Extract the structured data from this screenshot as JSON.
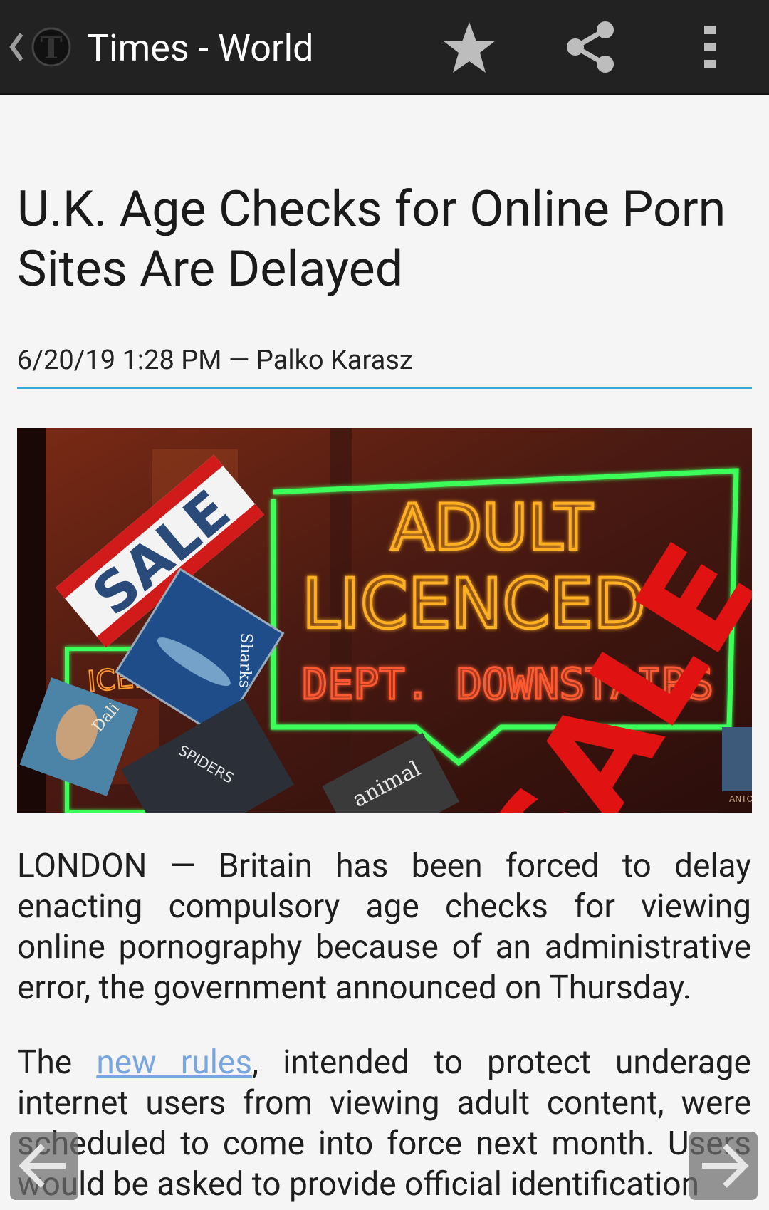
{
  "appbar": {
    "title": "Times - World",
    "icons": [
      "back-chevron-icon",
      "nyt-logo-icon",
      "star-icon",
      "share-icon",
      "overflow-menu-icon"
    ],
    "colors": {
      "background": "#222222",
      "text": "#ffffff",
      "icon": "#bdbdbd"
    }
  },
  "article": {
    "headline": "U.K. Age Checks for Online Porn Sites Are Delayed",
    "byline": "6/20/19 1:28 PM — Palko Karasz",
    "image": {
      "neon_line1": "ADULT",
      "neon_line2": "LICENCED",
      "neon_line3": "DEPT. DOWNSTAIRS",
      "sale_sign_left": "SALE",
      "sale_sign_right": "SALE",
      "book1": "Sharks",
      "book2": "Dali",
      "book3": "SPIDERS",
      "book4": "animal",
      "back_neon": "ICENS",
      "corner_label": "ANTONI GA"
    },
    "paragraph1": "LONDON — Britain has been forced to delay enacting compulsory age checks for viewing online pornography because of an administrative error, the government announced on Thursday.",
    "paragraph2_before_link": "The ",
    "paragraph2_link": "new rules",
    "paragraph2_after_link": ", intended to protect underage internet users from viewing adult content, were scheduled to come into force next month. Users would be asked to provide official identification",
    "colors": {
      "rule": "#35a6d6",
      "link": "#7aa6e0",
      "text": "#1e1e1e"
    }
  },
  "navigation": {
    "prev_icon": "arrow-left-icon",
    "next_icon": "arrow-right-icon"
  }
}
